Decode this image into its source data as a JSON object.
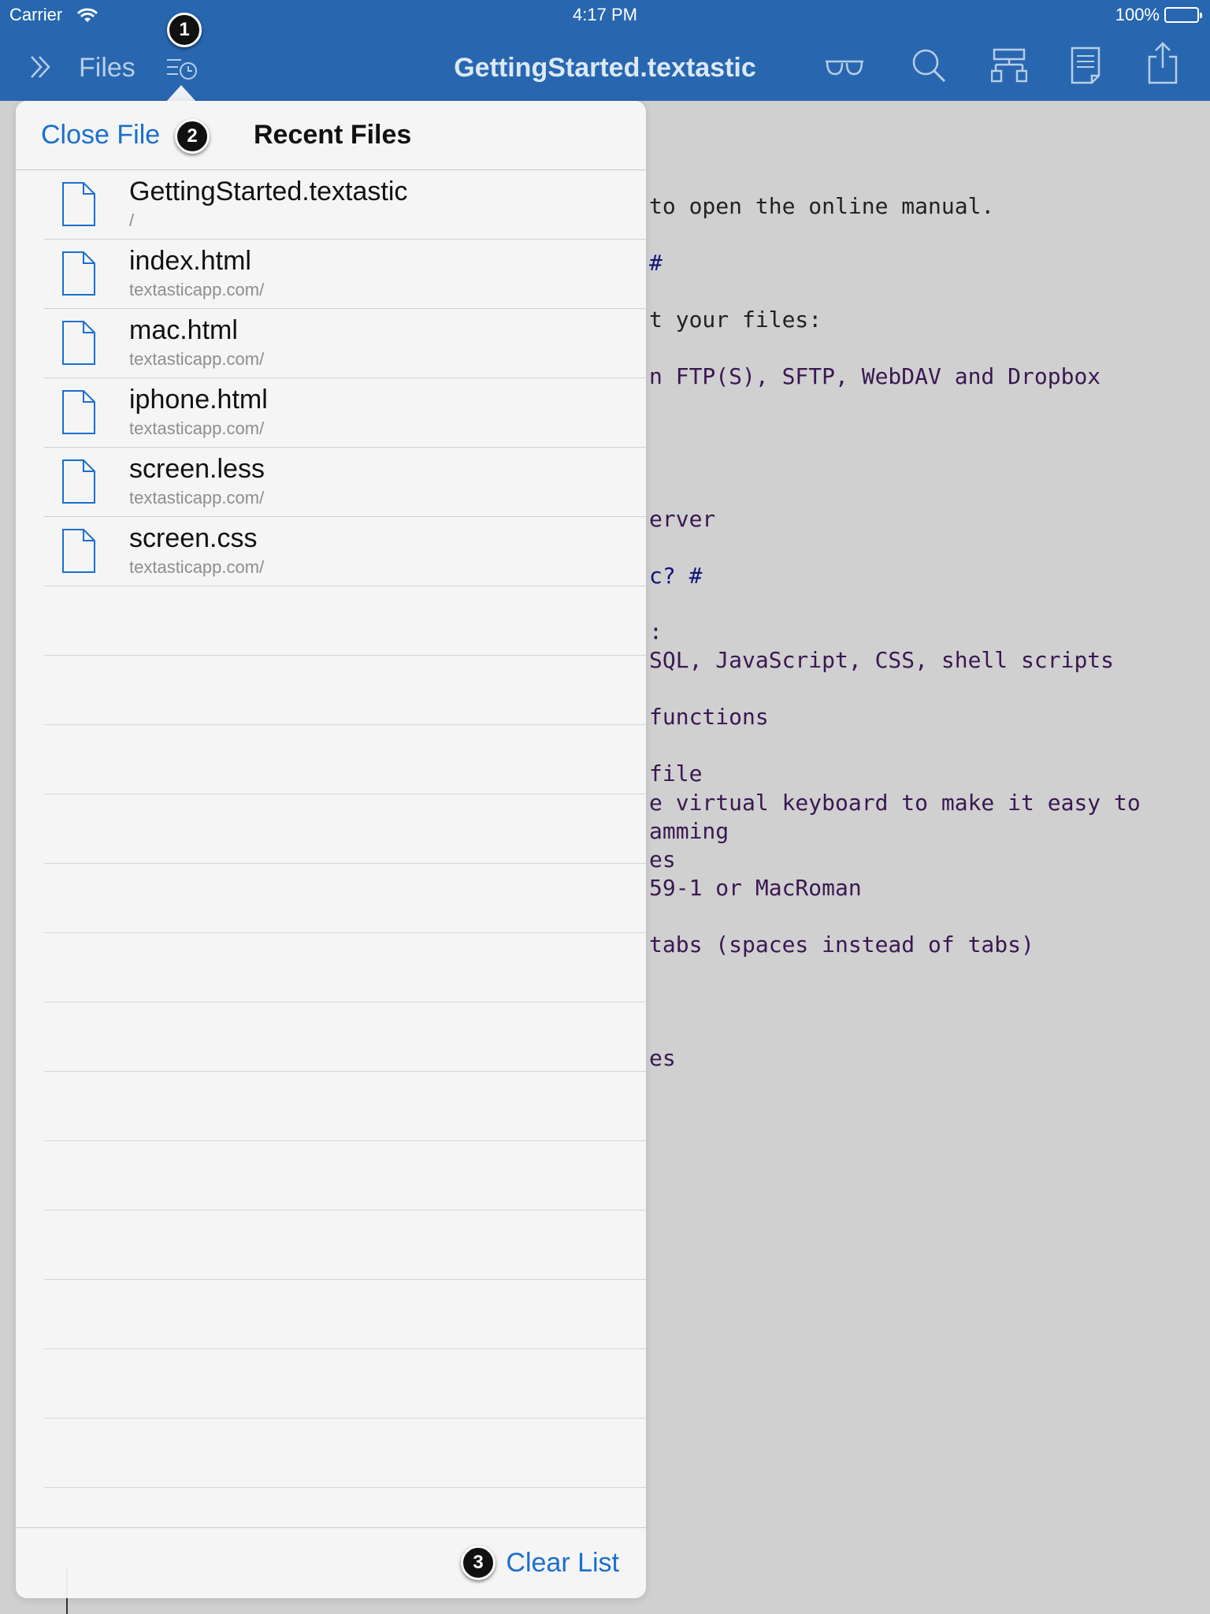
{
  "status_bar": {
    "carrier": "Carrier",
    "time": "4:17 PM",
    "battery": "100%"
  },
  "toolbar": {
    "files_label": "Files",
    "title": "GettingStarted.textastic",
    "icons": [
      "chevrons-right-icon",
      "recent-files-icon",
      "glasses-icon",
      "search-icon",
      "symbols-icon",
      "document-icon",
      "share-icon"
    ]
  },
  "popover": {
    "close_file_label": "Close File",
    "title": "Recent Files",
    "clear_list_label": "Clear List",
    "files": [
      {
        "name": "GettingStarted.textastic",
        "path": "/"
      },
      {
        "name": "index.html",
        "path": "textasticapp.com/"
      },
      {
        "name": "mac.html",
        "path": "textasticapp.com/"
      },
      {
        "name": "iphone.html",
        "path": "textasticapp.com/"
      },
      {
        "name": "screen.less",
        "path": "textasticapp.com/"
      },
      {
        "name": "screen.css",
        "path": "textasticapp.com/"
      }
    ]
  },
  "callouts": [
    "1",
    "2",
    "3"
  ],
  "editor": {
    "lines": [
      {
        "text": "to open the online manual.",
        "style": "plain"
      },
      {
        "text": "#",
        "style": "heading"
      },
      {
        "text": "t your files:",
        "style": "plain"
      },
      {
        "text": "n FTP(S), SFTP, WebDAV and Dropbox",
        "style": "text"
      },
      {
        "text": "erver",
        "style": "text"
      },
      {
        "text": "c? #",
        "style": "heading"
      },
      {
        "text": ":",
        "style": "text"
      },
      {
        "text": "SQL, JavaScript, CSS, shell scripts",
        "style": "text"
      },
      {
        "text": "functions",
        "style": "text"
      },
      {
        "text": "file",
        "style": "text"
      },
      {
        "text": "e virtual keyboard to make it easy to",
        "style": "text"
      },
      {
        "text": "amming",
        "style": "text"
      },
      {
        "text": "es",
        "style": "text"
      },
      {
        "text": "59-1 or MacRoman",
        "style": "text"
      },
      {
        "text": "tabs (spaces instead of tabs)",
        "style": "text"
      },
      {
        "text": "es",
        "style": "text"
      }
    ]
  },
  "colors": {
    "toolbar": "#2867b0",
    "accent": "#1a6fce",
    "editor_bg": "#d0d0d0"
  }
}
